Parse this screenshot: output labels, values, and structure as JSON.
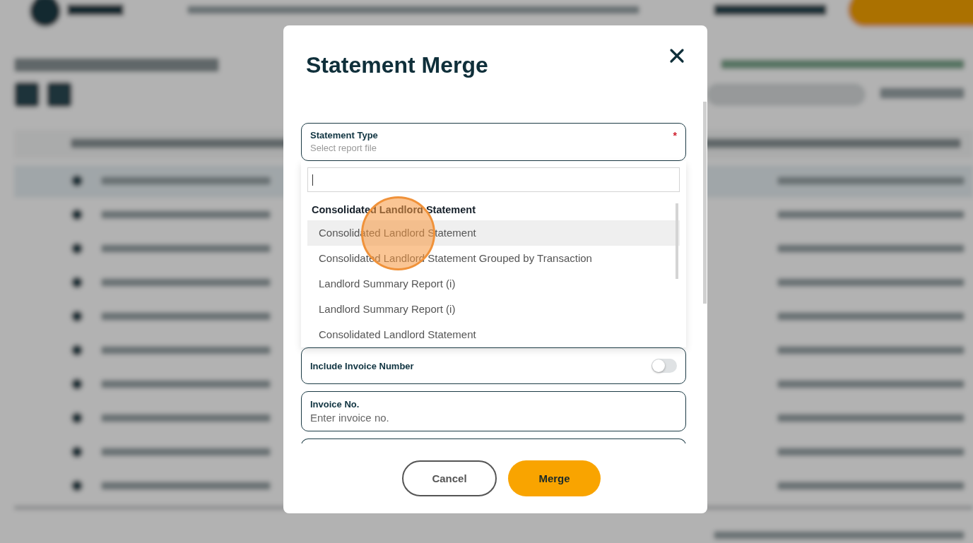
{
  "modal": {
    "title": "Statement Merge",
    "statement_type": {
      "label": "Statement Type",
      "required_mark": "*",
      "placeholder": "Select report file"
    },
    "dropdown": {
      "groups": [
        {
          "label": "Consolidated Landlord Statement",
          "options": [
            {
              "label": "Consolidated Landlord Statement",
              "highlighted": true
            },
            {
              "label": "Consolidated Landlord Statement Grouped by Transaction",
              "highlighted": false
            },
            {
              "label": "Landlord Summary Report (i)",
              "highlighted": false
            },
            {
              "label": "Landlord Summary Report (i)",
              "highlighted": false
            },
            {
              "label": "Consolidated Landlord Statement",
              "highlighted": false
            }
          ]
        }
      ]
    },
    "include_invoice_number": {
      "label": "Include Invoice Number",
      "on": false
    },
    "invoice_no": {
      "label": "Invoice No.",
      "placeholder": "Enter invoice no."
    },
    "buttons": [
      {
        "label": "Cancel",
        "kind": "secondary"
      },
      {
        "label": "Merge",
        "kind": "primary"
      }
    ]
  }
}
